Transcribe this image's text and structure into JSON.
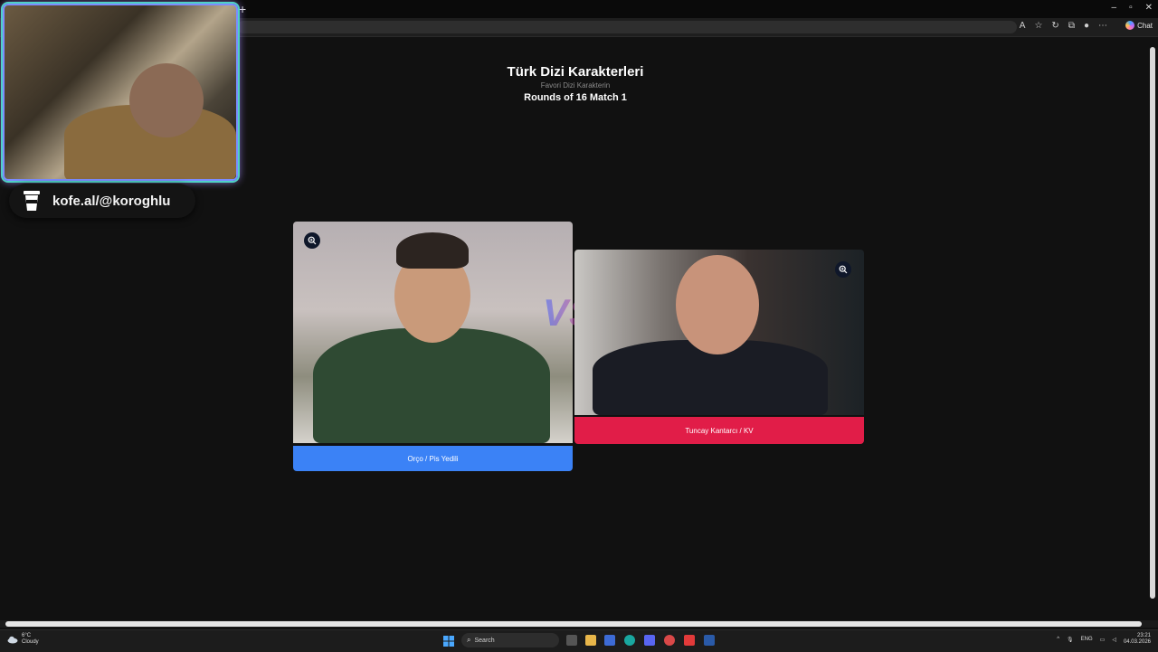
{
  "browser": {
    "newtab_label": "+",
    "chat_label": "Chat",
    "window_controls": [
      "–",
      "▫",
      "✕"
    ]
  },
  "page": {
    "title": "Türk Dizi Karakterleri",
    "subtitle": "Favori Dizi Karakterin",
    "round": "Rounds of 16 Match 1",
    "vs_text": "VS"
  },
  "matchup": {
    "left": {
      "name": "Orço / Pis Yedili",
      "color": "#3b82f6"
    },
    "right": {
      "name": "Tuncay Kantarcı / KV",
      "color": "#e11d48"
    }
  },
  "overlay": {
    "donation_text": "kofe.al/@koroghlu"
  },
  "taskbar": {
    "weather_temp": "6°C",
    "weather_desc": "Cloudy",
    "search_label": "Search",
    "language": "ENG",
    "time": "23:21",
    "date": "04.03.2026"
  }
}
